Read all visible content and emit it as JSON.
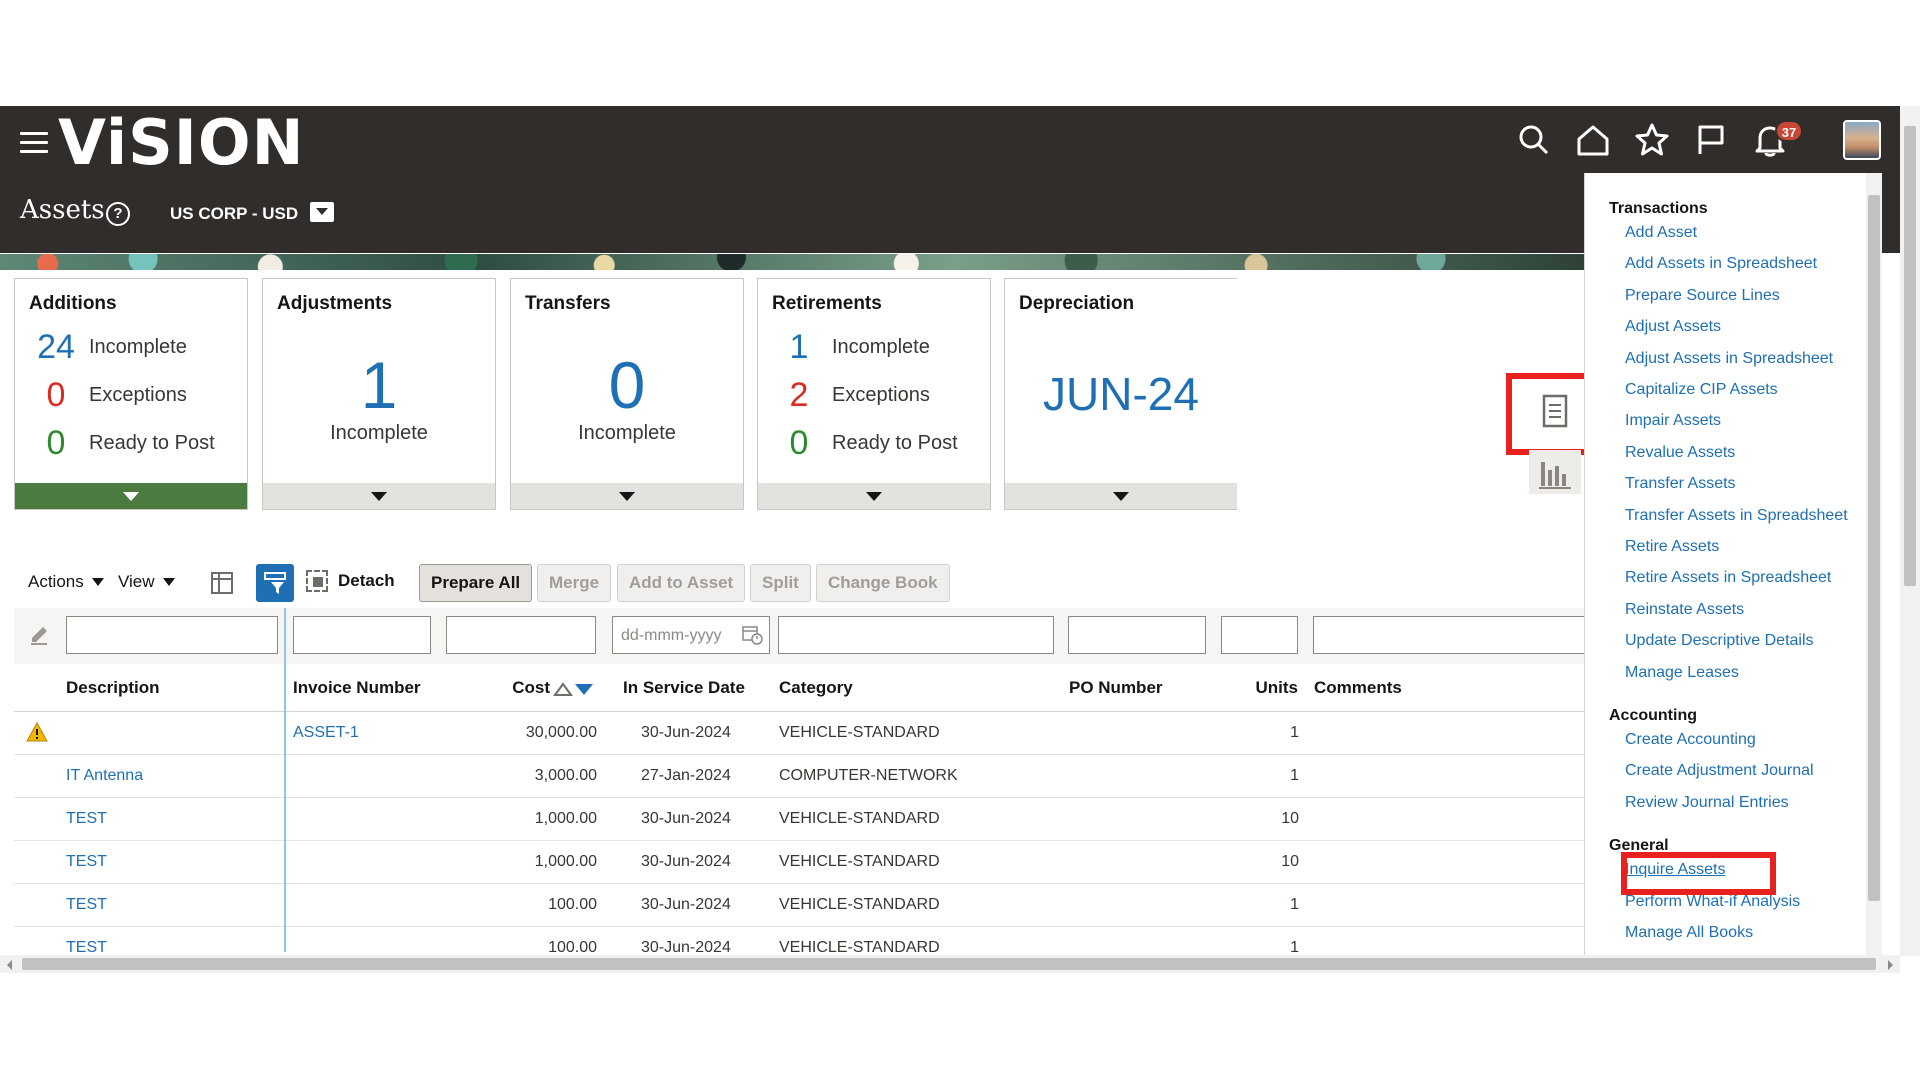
{
  "header": {
    "logo": "ViSION",
    "page_title": "Assets",
    "book": "US CORP - USD",
    "notification_count": "37",
    "icons": [
      "hamburger-icon",
      "search-icon",
      "home-icon",
      "favorites-star-icon",
      "flag-icon",
      "bell-icon",
      "user-avatar"
    ]
  },
  "tiles": {
    "additions": {
      "title": "Additions",
      "rows": [
        {
          "value": "24",
          "label": "Incomplete",
          "color": "#1e6fb3"
        },
        {
          "value": "0",
          "label": "Exceptions",
          "color": "#d92b20"
        },
        {
          "value": "0",
          "label": "Ready to Post",
          "color": "#2e8a2e"
        }
      ]
    },
    "adjustments": {
      "title": "Adjustments",
      "value": "1",
      "label": "Incomplete"
    },
    "transfers": {
      "title": "Transfers",
      "value": "0",
      "label": "Incomplete"
    },
    "retirements": {
      "title": "Retirements",
      "rows": [
        {
          "value": "1",
          "label": "Incomplete",
          "color": "#1e6fb3"
        },
        {
          "value": "2",
          "label": "Exceptions",
          "color": "#d92b20"
        },
        {
          "value": "0",
          "label": "Ready to Post",
          "color": "#2e8a2e"
        }
      ]
    },
    "depreciation": {
      "title": "Depreciation",
      "period": "JUN-24"
    }
  },
  "toolbar": {
    "actions": "Actions",
    "view": "View",
    "detach": "Detach",
    "prepare_all": "Prepare All",
    "merge": "Merge",
    "add_to_asset": "Add to Asset",
    "split": "Split",
    "change_book": "Change Book"
  },
  "table": {
    "date_placeholder": "dd-mmm-yyyy",
    "columns": [
      "Description",
      "Invoice Number",
      "Cost",
      "In Service Date",
      "Category",
      "PO Number",
      "Units",
      "Comments"
    ],
    "rows": [
      {
        "warning": true,
        "description": "",
        "invoice": "ASSET-1",
        "cost": "30,000.00",
        "date": "30-Jun-2024",
        "category": "VEHICLE-STANDARD",
        "po": "",
        "units": "1",
        "comments": ""
      },
      {
        "warning": false,
        "description": "IT Antenna",
        "invoice": "",
        "cost": "3,000.00",
        "date": "27-Jan-2024",
        "category": "COMPUTER-NETWORK",
        "po": "",
        "units": "1",
        "comments": ""
      },
      {
        "warning": false,
        "description": "TEST",
        "invoice": "",
        "cost": "1,000.00",
        "date": "30-Jun-2024",
        "category": "VEHICLE-STANDARD",
        "po": "",
        "units": "10",
        "comments": ""
      },
      {
        "warning": false,
        "description": "TEST",
        "invoice": "",
        "cost": "1,000.00",
        "date": "30-Jun-2024",
        "category": "VEHICLE-STANDARD",
        "po": "",
        "units": "10",
        "comments": ""
      },
      {
        "warning": false,
        "description": "TEST",
        "invoice": "",
        "cost": "100.00",
        "date": "30-Jun-2024",
        "category": "VEHICLE-STANDARD",
        "po": "",
        "units": "1",
        "comments": ""
      },
      {
        "warning": false,
        "description": "TEST",
        "invoice": "",
        "cost": "100.00",
        "date": "30-Jun-2024",
        "category": "VEHICLE-STANDARD",
        "po": "",
        "units": "1",
        "comments": ""
      }
    ]
  },
  "tasks": {
    "sections": [
      {
        "title": "Transactions",
        "items": [
          "Add Asset",
          "Add Assets in Spreadsheet",
          "Prepare Source Lines",
          "Adjust Assets",
          "Adjust Assets in Spreadsheet",
          "Capitalize CIP Assets",
          "Impair Assets",
          "Revalue Assets",
          "Transfer Assets",
          "Transfer Assets in Spreadsheet",
          "Retire Assets",
          "Retire Assets in Spreadsheet",
          "Reinstate Assets",
          "Update Descriptive Details",
          "Manage Leases"
        ]
      },
      {
        "title": "Accounting",
        "items": [
          "Create Accounting",
          "Create Adjustment Journal",
          "Review Journal Entries"
        ]
      },
      {
        "title": "General",
        "items": [
          "Inquire Assets",
          "Perform What-if Analysis",
          "Manage All Books"
        ]
      }
    ]
  },
  "colors": {
    "header_bg": "#312d2a",
    "link": "#1e6fb3",
    "highlight_box": "#e8201e",
    "tile_active_footer": "#4b7b3f"
  }
}
